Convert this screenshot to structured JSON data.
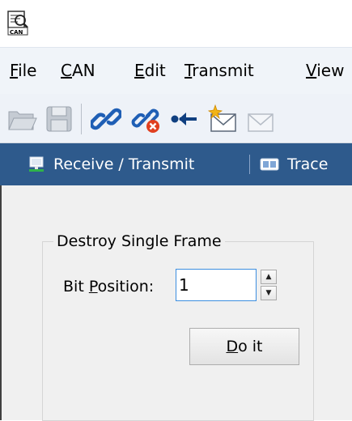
{
  "menu": {
    "file": {
      "mnemonic": "F",
      "rest": "ile"
    },
    "can": {
      "mnemonic": "C",
      "rest": "AN"
    },
    "edit": {
      "mnemonic": "E",
      "rest": "dit"
    },
    "transmit": {
      "mnemonic": "T",
      "rest": "ransmit"
    },
    "view": {
      "mnemonic": "V",
      "rest": "iew"
    }
  },
  "toolbar": {
    "icons": [
      "folder-open-icon",
      "save-icon",
      "connect-icon",
      "disconnect-icon",
      "receive-icon",
      "new-message-icon",
      "message-icon"
    ]
  },
  "tabs": [
    {
      "label": "Receive / Transmit",
      "icon": "monitor-icon"
    },
    {
      "label": "Trace",
      "icon": "trace-icon"
    }
  ],
  "panel": {
    "group_title": "Destroy Single Frame",
    "bit_position": {
      "label_prefix": "Bit ",
      "label_mnemonic": "P",
      "label_rest": "osition:",
      "value": "1"
    },
    "spinner": {
      "up": "▲",
      "down": "▼"
    },
    "do_it": {
      "mnemonic": "D",
      "rest": "o it"
    }
  },
  "colors": {
    "menubar_bg": "#f0f4f9",
    "toolbar_bg": "#eef2f8",
    "tabbar_bg": "#2e5a8c",
    "panel_bg": "#f0f0f0",
    "input_border": "#3d8ee0"
  }
}
